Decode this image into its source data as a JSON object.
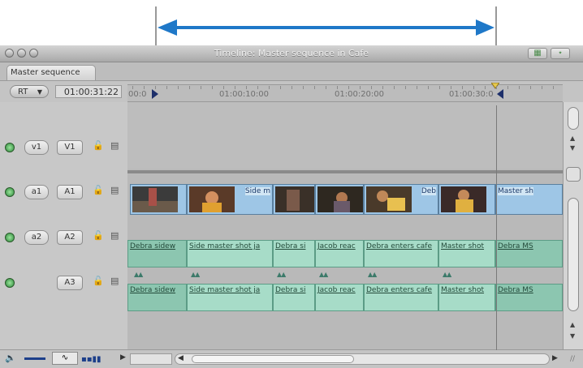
{
  "window": {
    "title": "Timeline: Master sequence in Cafe",
    "tab": "Master sequence"
  },
  "controls": {
    "rt_label": "RT",
    "timecode": "01:00:31:22"
  },
  "ruler": {
    "start_label": "00:0",
    "labels": [
      "01:00:10:00",
      "01:00:20:00",
      "01:00:30:0"
    ]
  },
  "tracks": [
    {
      "source": "v1",
      "dest": "V1",
      "type": "video"
    },
    {
      "source": "a1",
      "dest": "A1",
      "type": "audio"
    },
    {
      "source": "a2",
      "dest": "A2",
      "type": "audio"
    },
    {
      "source": "",
      "dest": "A3",
      "type": "audio"
    }
  ],
  "video_clips": [
    {
      "label": ""
    },
    {
      "label": "Side m"
    },
    {
      "label": ""
    },
    {
      "label": ""
    },
    {
      "label": "Deb"
    },
    {
      "label": ""
    },
    {
      "label": "Master sh"
    }
  ],
  "audio_clips": [
    {
      "label": "Debra sidew"
    },
    {
      "label": "Side master shot ja"
    },
    {
      "label": "Debra si"
    },
    {
      "label": "Jacob reac"
    },
    {
      "label": "Debra enters cafe"
    },
    {
      "label": "Master shot"
    },
    {
      "label": "Debra MS"
    }
  ],
  "annotation": {
    "color": "#1f78c8"
  },
  "colors": {
    "video_clip": "#9ec6e6",
    "audio_clip": "#a7dcc8",
    "audio_selected": "#8cc6b0"
  }
}
